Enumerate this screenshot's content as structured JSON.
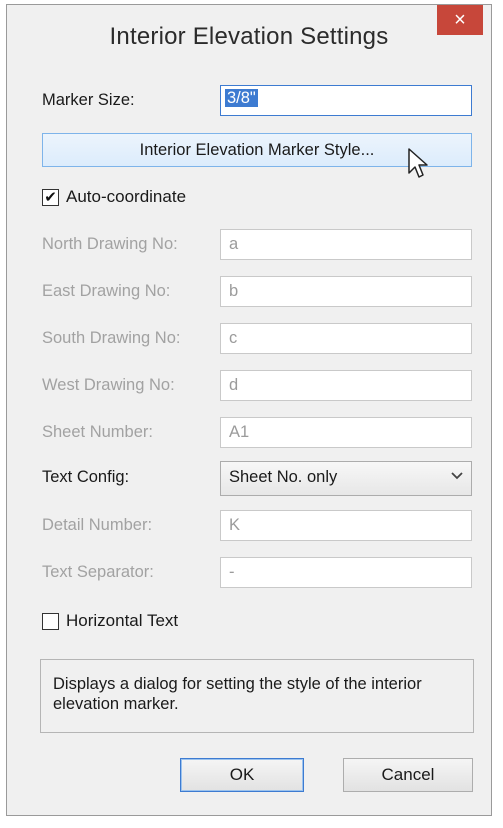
{
  "window": {
    "title": "Interior Elevation Settings",
    "close_glyph": "×"
  },
  "marker_size": {
    "label": "Marker Size:",
    "value": "3/8\""
  },
  "style_button": {
    "label": "Interior Elevation Marker Style..."
  },
  "auto_coordinate": {
    "label": "Auto-coordinate",
    "checked": true,
    "check_glyph": "✔"
  },
  "fields": [
    {
      "label": "North Drawing No:",
      "value": "a",
      "enabled": false
    },
    {
      "label": "East Drawing No:",
      "value": "b",
      "enabled": false
    },
    {
      "label": "South Drawing No:",
      "value": "c",
      "enabled": false
    },
    {
      "label": "West Drawing No:",
      "value": "d",
      "enabled": false
    },
    {
      "label": "Sheet Number:",
      "value": "A1",
      "enabled": false
    }
  ],
  "text_config": {
    "label": "Text Config:",
    "value": "Sheet No. only",
    "chevron": "⌄"
  },
  "detail_number": {
    "label": "Detail Number:",
    "value": "K",
    "enabled": false
  },
  "text_separator": {
    "label": "Text Separator:",
    "value": "-",
    "enabled": false
  },
  "horizontal_text": {
    "label": "Horizontal Text",
    "checked": false
  },
  "help_text": "Displays a dialog for setting the style of the interior elevation marker.",
  "buttons": {
    "ok": "OK",
    "cancel": "Cancel"
  },
  "colors": {
    "accent": "#3d7bd1",
    "close": "#c7473a",
    "disabled_text": "#a2a2a2"
  },
  "icons": {
    "close": "close-icon",
    "pointer": "mouse-pointer-icon",
    "check": "checkmark-icon",
    "dropdown": "chevron-down-icon"
  }
}
